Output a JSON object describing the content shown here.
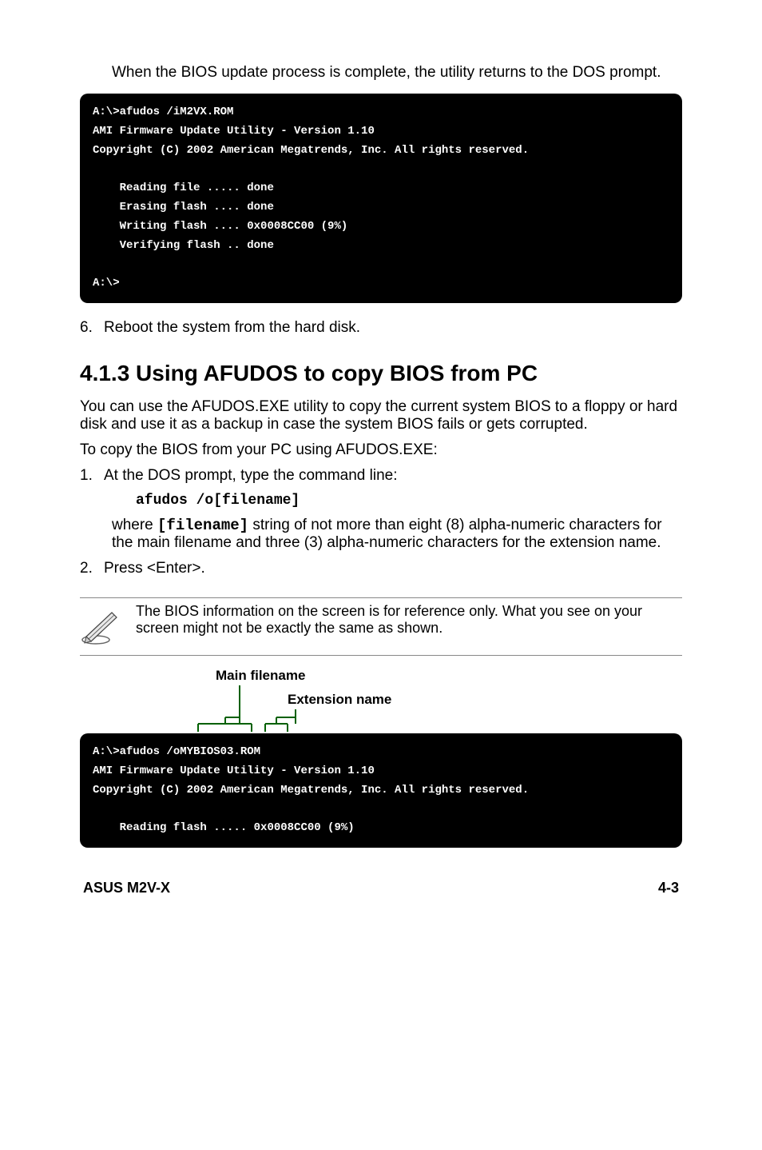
{
  "intro": "When the BIOS update process is complete, the utility returns to the DOS prompt.",
  "terminal1": "A:\\>afudos /iM2VX.ROM\nAMI Firmware Update Utility - Version 1.10\nCopyright (C) 2002 American Megatrends, Inc. All rights reserved.\n\n    Reading file ..... done\n    Erasing flash .... done\n    Writing flash .... 0x0008CC00 (9%)\n    Verifying flash .. done\n\nA:\\>",
  "step6": {
    "num": "6.",
    "text": "Reboot the system from the hard disk."
  },
  "section_title": "4.1.3  Using AFUDOS to copy BIOS from PC",
  "para1": "You can use the AFUDOS.EXE utility to copy the current system BIOS to a floppy or hard disk and use it as a backup in case the system BIOS fails or gets corrupted.",
  "para2": "To copy the BIOS from your PC using AFUDOS.EXE:",
  "step1": {
    "num": "1.",
    "text": "At the DOS prompt, type the command line:"
  },
  "code": "afudos /o[filename]",
  "where": {
    "pre": "where ",
    "code": "[filename]",
    "post": " string of not more than eight (8) alpha-numeric characters for the main filename and three (3) alpha-numeric characters for the extension name."
  },
  "step2": {
    "num": "2.",
    "text": "Press <Enter>."
  },
  "note": "The BIOS information on the screen is for reference only. What you see on your screen might not be exactly the same as shown.",
  "label_main": "Main filename",
  "label_ext": "Extension name",
  "terminal2": "A:\\>afudos /oMYBIOS03.ROM\nAMI Firmware Update Utility - Version 1.10\nCopyright (C) 2002 American Megatrends, Inc. All rights reserved.\n\n    Reading flash ..... 0x0008CC00 (9%)",
  "footer_left": "ASUS M2V-X",
  "footer_right": "4-3"
}
